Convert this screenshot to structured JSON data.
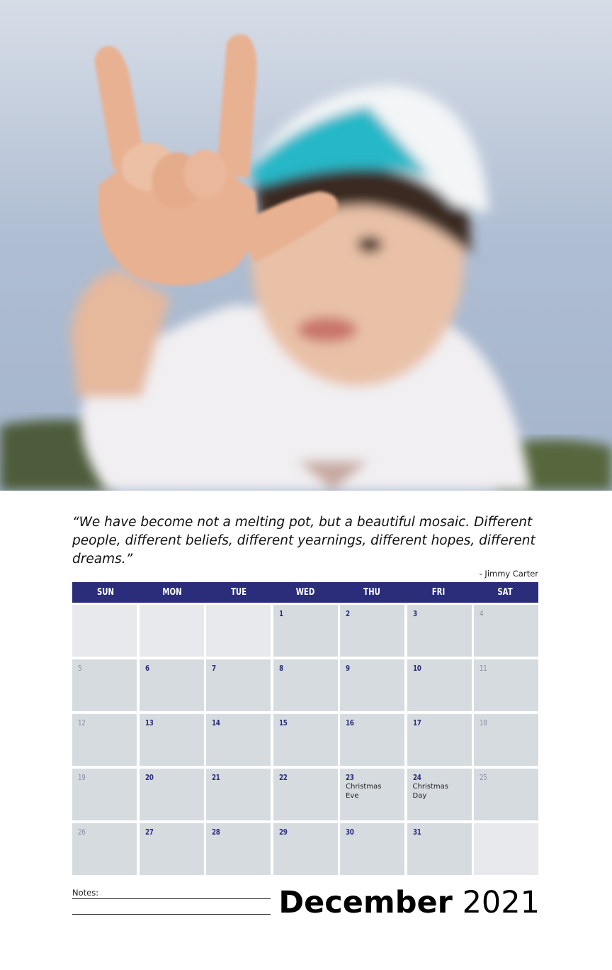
{
  "quote": {
    "text": "“We have become not a melting pot, but a beautiful mosaic. Different people, different beliefs, different yearnings, different hopes, different dreams.”",
    "author": "- Jimmy Carter"
  },
  "calendar": {
    "weekdays": [
      "SUN",
      "MON",
      "TUE",
      "WED",
      "THU",
      "FRI",
      "SAT"
    ],
    "weeks": [
      [
        {
          "day": ""
        },
        {
          "day": ""
        },
        {
          "day": ""
        },
        {
          "day": "1"
        },
        {
          "day": "2"
        },
        {
          "day": "3"
        },
        {
          "day": "4"
        }
      ],
      [
        {
          "day": "5"
        },
        {
          "day": "6"
        },
        {
          "day": "7"
        },
        {
          "day": "8"
        },
        {
          "day": "9"
        },
        {
          "day": "10"
        },
        {
          "day": "11"
        }
      ],
      [
        {
          "day": "12"
        },
        {
          "day": "13"
        },
        {
          "day": "14"
        },
        {
          "day": "15"
        },
        {
          "day": "16"
        },
        {
          "day": "17"
        },
        {
          "day": "18"
        }
      ],
      [
        {
          "day": "19"
        },
        {
          "day": "20"
        },
        {
          "day": "21"
        },
        {
          "day": "22"
        },
        {
          "day": "23",
          "event": "Christmas Eve"
        },
        {
          "day": "24",
          "event": "Christmas Day"
        },
        {
          "day": "25"
        }
      ],
      [
        {
          "day": "26"
        },
        {
          "day": "27"
        },
        {
          "day": "28"
        },
        {
          "day": "29"
        },
        {
          "day": "30"
        },
        {
          "day": "31"
        },
        {
          "day": ""
        }
      ]
    ]
  },
  "footer": {
    "notes_label": "Notes:",
    "month": "December",
    "year": "2021"
  },
  "colors": {
    "header_bg": "#2b2d7a",
    "cell_bg": "#d6dbe0",
    "empty_cell_bg": "#e8e9ec"
  }
}
